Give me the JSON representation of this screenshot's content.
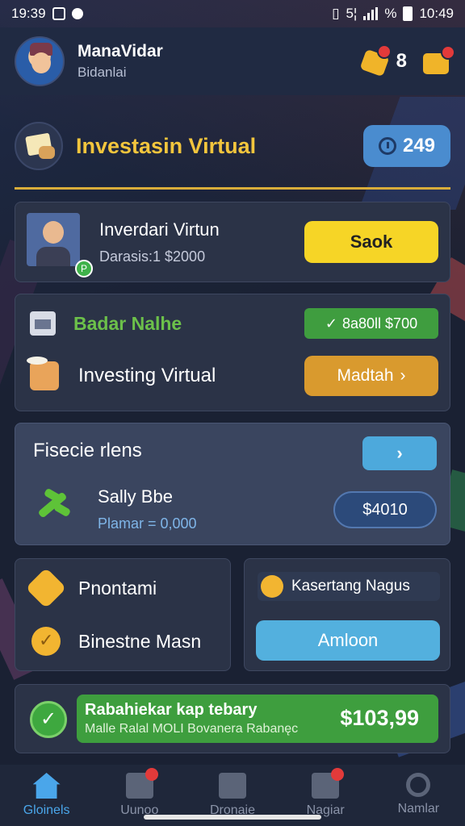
{
  "status_bar": {
    "time": "19:39",
    "battery_text": "%",
    "time_right": "10:49",
    "network": "5¦"
  },
  "header": {
    "user_name": "ManaVidar",
    "user_subtitle": "Bidanlai",
    "coin_count": "8"
  },
  "title_row": {
    "title": "Investasin Virtual",
    "counter": "249"
  },
  "card_profile": {
    "title": "Inverdari Virtun",
    "subtitle": "Darasis:1 $2000",
    "button": "Saok"
  },
  "card_balance": {
    "label": "Badar Nalhe",
    "badge": "8a80ll $700",
    "investing_label": "Investing Virtual",
    "button": "Madtah",
    "button_arrow": "›"
  },
  "card_fisecie": {
    "title": "Fisecie rlens",
    "arrow": "›",
    "name": "Sally Bbe",
    "sub": "Plamar = 0,000",
    "button": "$4010"
  },
  "card_left": {
    "item1": "Pnontami",
    "item2": "Binestne Masn"
  },
  "card_right": {
    "label": "Kasertang Nagus",
    "button": "Amloon"
  },
  "banner": {
    "title": "Rabahiekar kap tebary",
    "subtitle": "Malle Ralal MOLI Bovanera Rabanęc",
    "amount": "$103,99"
  },
  "bottom_nav": [
    {
      "label": "Gloinels",
      "icon": "home-icon",
      "active": true
    },
    {
      "label": "Uunoo",
      "icon": "chat-icon",
      "active": false
    },
    {
      "label": "Dronaie",
      "icon": "layout-icon",
      "active": false
    },
    {
      "label": "Nagiar",
      "icon": "mail-icon",
      "active": false
    },
    {
      "label": "Namlar",
      "icon": "search-icon",
      "active": false
    }
  ],
  "colors": {
    "accent_yellow": "#f2c53d",
    "accent_blue": "#4aa6ea",
    "accent_green": "#3e9e3e",
    "background": "#1a2133"
  }
}
